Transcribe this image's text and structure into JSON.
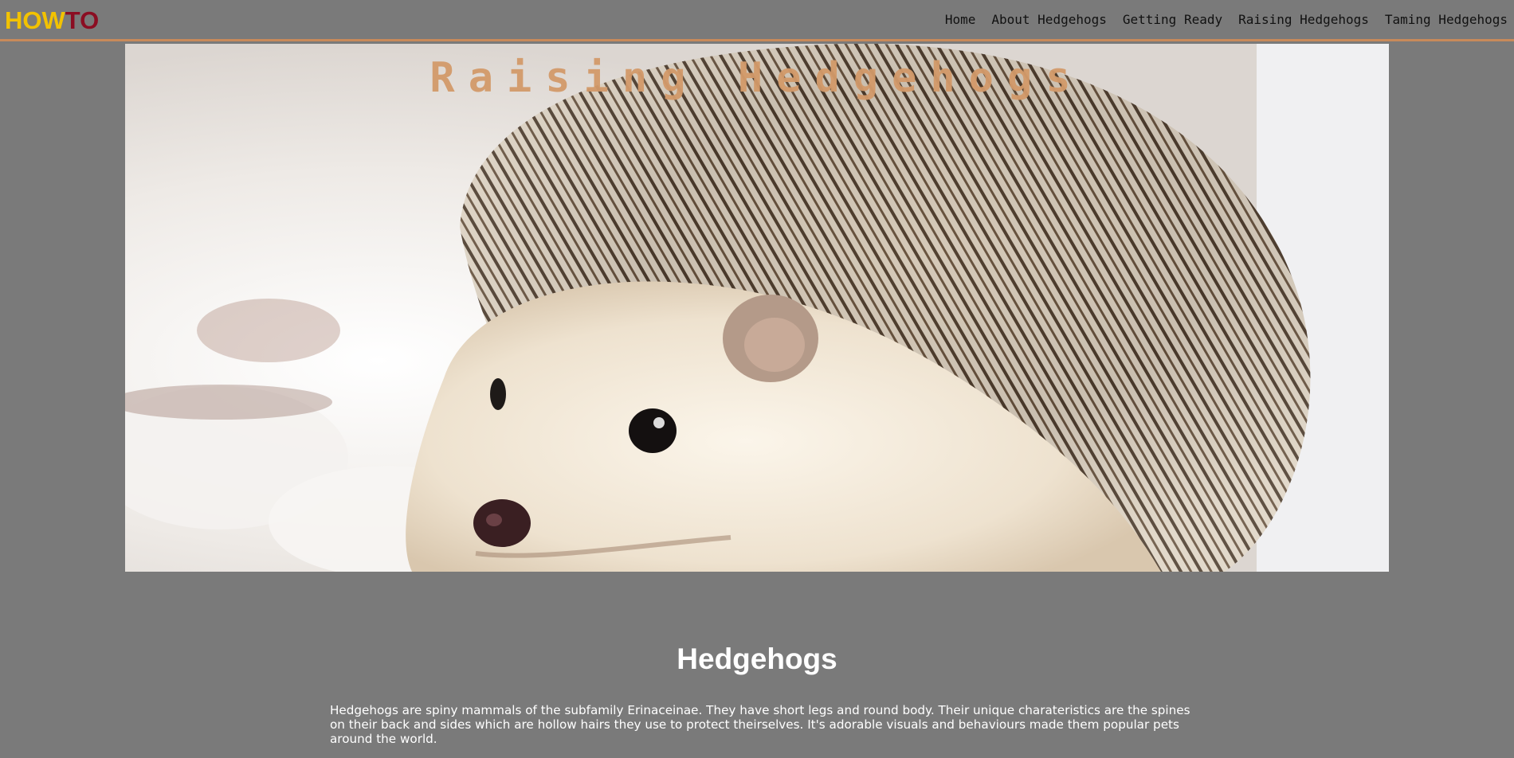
{
  "brand": {
    "part1": "HOW",
    "part2": "TO",
    "color_part1": "#f2c200",
    "color_part2": "#8b0d22"
  },
  "nav": {
    "items": [
      {
        "label": "Home"
      },
      {
        "label": "About Hedgehogs"
      },
      {
        "label": "Getting Ready"
      },
      {
        "label": "Raising Hedgehogs"
      },
      {
        "label": "Taming Hedgehogs"
      }
    ],
    "border_color": "#c88a5a"
  },
  "hero": {
    "title": "Raising Hedgehogs",
    "image_icon": "hedgehog-photo"
  },
  "section": {
    "title": "Hedgehogs",
    "paragraph": "Hedgehogs are spiny mammals of the subfamily Erinaceinae. They have short legs and round body. Their unique charateristics are the spines on their back and sides which are hollow hairs they use to protect theirselves. It's adorable visuals and behaviours made them popular pets around the world."
  },
  "colors": {
    "page_background": "#7a7a7a",
    "hero_title": "#d39a6a"
  }
}
